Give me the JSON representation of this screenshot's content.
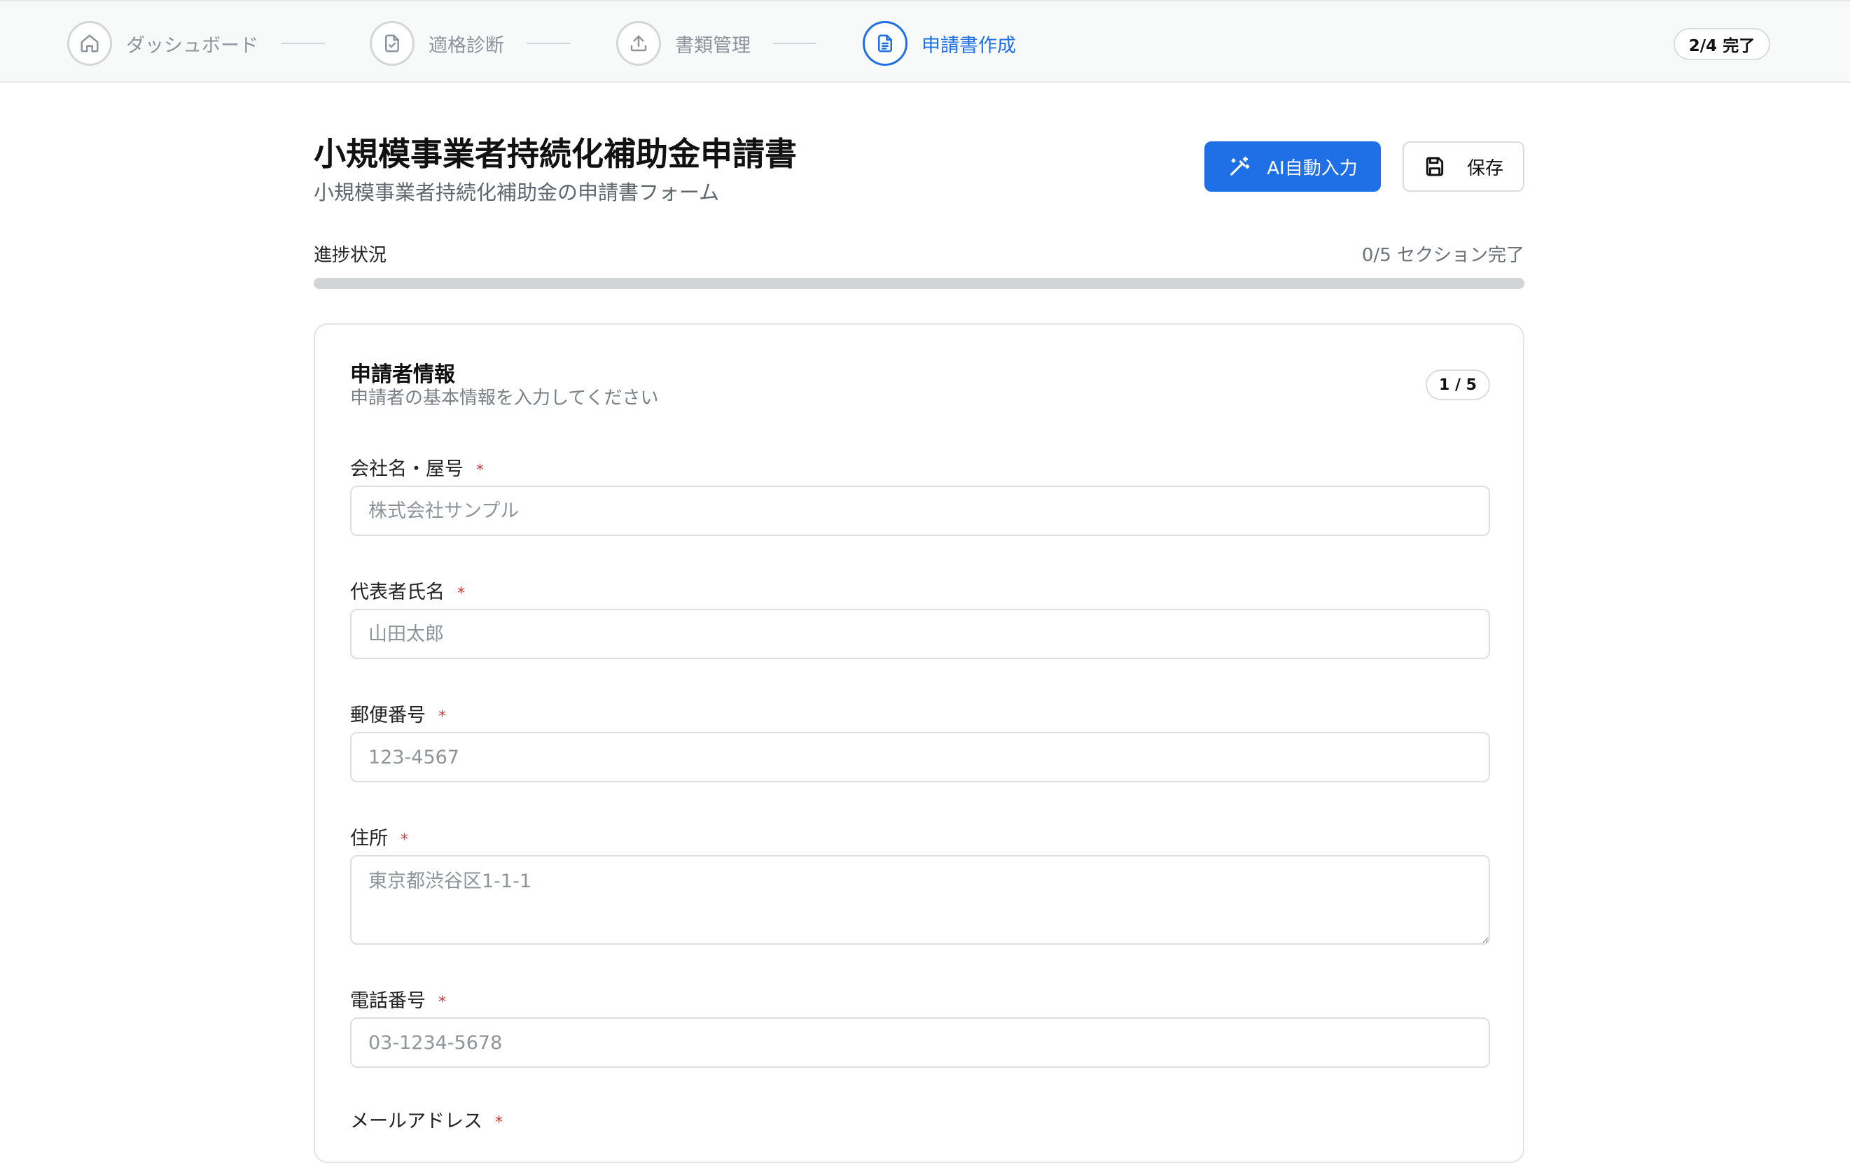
{
  "stepper": {
    "steps": [
      {
        "label": "ダッシュボード",
        "icon": "home-icon"
      },
      {
        "label": "適格診断",
        "icon": "file-check-icon"
      },
      {
        "label": "書類管理",
        "icon": "upload-icon"
      },
      {
        "label": "申請書作成",
        "icon": "file-text-icon",
        "active": true
      }
    ],
    "progress_badge": "2/4 完了"
  },
  "header": {
    "title": "小規模事業者持続化補助金申請書",
    "subtitle": "小規模事業者持続化補助金の申請書フォーム",
    "ai_button_label": "AI自動入力",
    "save_button_label": "保存"
  },
  "progress": {
    "label": "進捗状況",
    "count_text": "0/5 セクション完了",
    "fraction": 0
  },
  "section": {
    "title": "申請者情報",
    "description": "申請者の基本情報を入力してください",
    "badge": "1 / 5",
    "fields": [
      {
        "label": "会社名・屋号",
        "required": "*",
        "placeholder": "株式会社サンプル",
        "value": ""
      },
      {
        "label": "代表者氏名",
        "required": "*",
        "placeholder": "山田太郎",
        "value": ""
      },
      {
        "label": "郵便番号",
        "required": "*",
        "placeholder": "123-4567",
        "value": ""
      },
      {
        "label": "住所",
        "required": "*",
        "placeholder": "東京都渋谷区1-1-1",
        "value": ""
      },
      {
        "label": "電話番号",
        "required": "*",
        "placeholder": "03-1234-5678",
        "value": ""
      },
      {
        "label": "メールアドレス",
        "required": "*"
      }
    ]
  },
  "colors": {
    "accent": "#1f6fe6",
    "required": "#d93636",
    "progress_track": "#d3d4d5"
  }
}
